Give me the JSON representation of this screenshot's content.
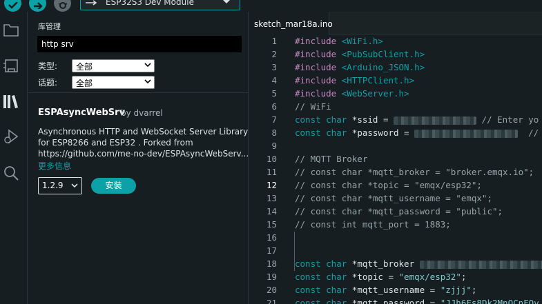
{
  "toolbar": {
    "board_name": "ESP32S3 Dev Module",
    "icons": [
      "verify-icon",
      "upload-icon",
      "debug-icon",
      "usb-icon",
      "chevron-down-icon"
    ]
  },
  "activity_bar": {
    "icons": [
      "folder-icon",
      "boards-manager-icon",
      "library-manager-icon",
      "debug-icon",
      "search-icon"
    ]
  },
  "library_manager": {
    "title": "库管理",
    "search_value": "http srv",
    "type_label": "类型:",
    "type_value": "全部",
    "topic_label": "话题:",
    "topic_value": "全部",
    "item": {
      "name": "ESPAsyncWebSrv",
      "by": "by dvarrel",
      "desc_line1": "Asynchronous HTTP and WebSocket Server Library",
      "desc_line2": "for ESP8266 and ESP32 . Forked from",
      "desc_line3": "https://github.com/me-no-dev/ESPAsyncWebServ...",
      "more_info": "更多信息",
      "version": "1.2.9",
      "install_label": "安装"
    }
  },
  "editor": {
    "tab_name": "sketch_mar18a.ino",
    "active_line": 12,
    "lines": [
      {
        "n": "1",
        "parts": [
          [
            "kw",
            "#include "
          ],
          [
            "inc",
            "<WiFi.h>"
          ]
        ]
      },
      {
        "n": "2",
        "parts": [
          [
            "kw",
            "#include "
          ],
          [
            "inc",
            "<PubSubClient.h>"
          ]
        ]
      },
      {
        "n": "3",
        "parts": [
          [
            "kw",
            "#include "
          ],
          [
            "inc",
            "<Arduino_JSON.h>"
          ]
        ]
      },
      {
        "n": "4",
        "parts": [
          [
            "kw",
            "#include "
          ],
          [
            "inc",
            "<HTTPClient.h>"
          ]
        ]
      },
      {
        "n": "5",
        "parts": [
          [
            "kw",
            "#include "
          ],
          [
            "inc",
            "<WebServer.h>"
          ]
        ]
      },
      {
        "n": "6",
        "parts": [
          [
            "cm",
            "// WiFi"
          ]
        ]
      },
      {
        "n": "7",
        "parts": [
          [
            "ty",
            "const char "
          ],
          [
            "tx",
            "*ssid = "
          ],
          [
            "blur",
            "120"
          ],
          [
            "cm",
            " // Enter yo"
          ]
        ]
      },
      {
        "n": "8",
        "parts": [
          [
            "ty",
            "const char "
          ],
          [
            "tx",
            "*password = "
          ],
          [
            "blur",
            "150"
          ],
          [
            "cm",
            "  //"
          ]
        ]
      },
      {
        "n": "9",
        "parts": []
      },
      {
        "n": "10",
        "parts": [
          [
            "cm",
            "// MQTT Broker"
          ]
        ]
      },
      {
        "n": "11",
        "parts": [
          [
            "cm",
            "// const char *mqtt_broker = \"broker.emqx.io\";"
          ]
        ]
      },
      {
        "n": "12",
        "parts": [
          [
            "cm",
            "// const char *topic = \"emqx/esp32\";"
          ]
        ]
      },
      {
        "n": "13",
        "parts": [
          [
            "cm",
            "// const char *mqtt_username = \"emqx\";"
          ]
        ]
      },
      {
        "n": "14",
        "parts": [
          [
            "cm",
            "// const char *mqtt_password = \"public\";"
          ]
        ]
      },
      {
        "n": "15",
        "parts": [
          [
            "cm",
            "// const int mqtt_port = 1883;"
          ]
        ]
      },
      {
        "n": "16",
        "parts": []
      },
      {
        "n": "17",
        "parts": []
      },
      {
        "n": "18",
        "parts": [
          [
            "ty",
            "const char "
          ],
          [
            "tx",
            "*mqtt_broker "
          ],
          [
            "blur",
            "185"
          ]
        ]
      },
      {
        "n": "19",
        "parts": [
          [
            "ty",
            "const char "
          ],
          [
            "tx",
            "*topic = "
          ],
          [
            "st",
            "\"emqx/esp32\""
          ],
          [
            "tx",
            ";"
          ]
        ]
      },
      {
        "n": "20",
        "parts": [
          [
            "ty",
            "const char "
          ],
          [
            "tx",
            "*mqtt_username = "
          ],
          [
            "st",
            "\"zjjj\""
          ],
          [
            "tx",
            ";"
          ]
        ]
      },
      {
        "n": "21",
        "parts": [
          [
            "ty",
            "const char "
          ],
          [
            "tx",
            "*mqtt_password = "
          ],
          [
            "st",
            "\"JJh6Fs8Dk2MnQCnFQv"
          ]
        ]
      }
    ]
  },
  "colors": {
    "accent": "#0ca1a6",
    "background": "#171e21",
    "keyword": "#c586c0",
    "comment": "#95a5a6"
  }
}
